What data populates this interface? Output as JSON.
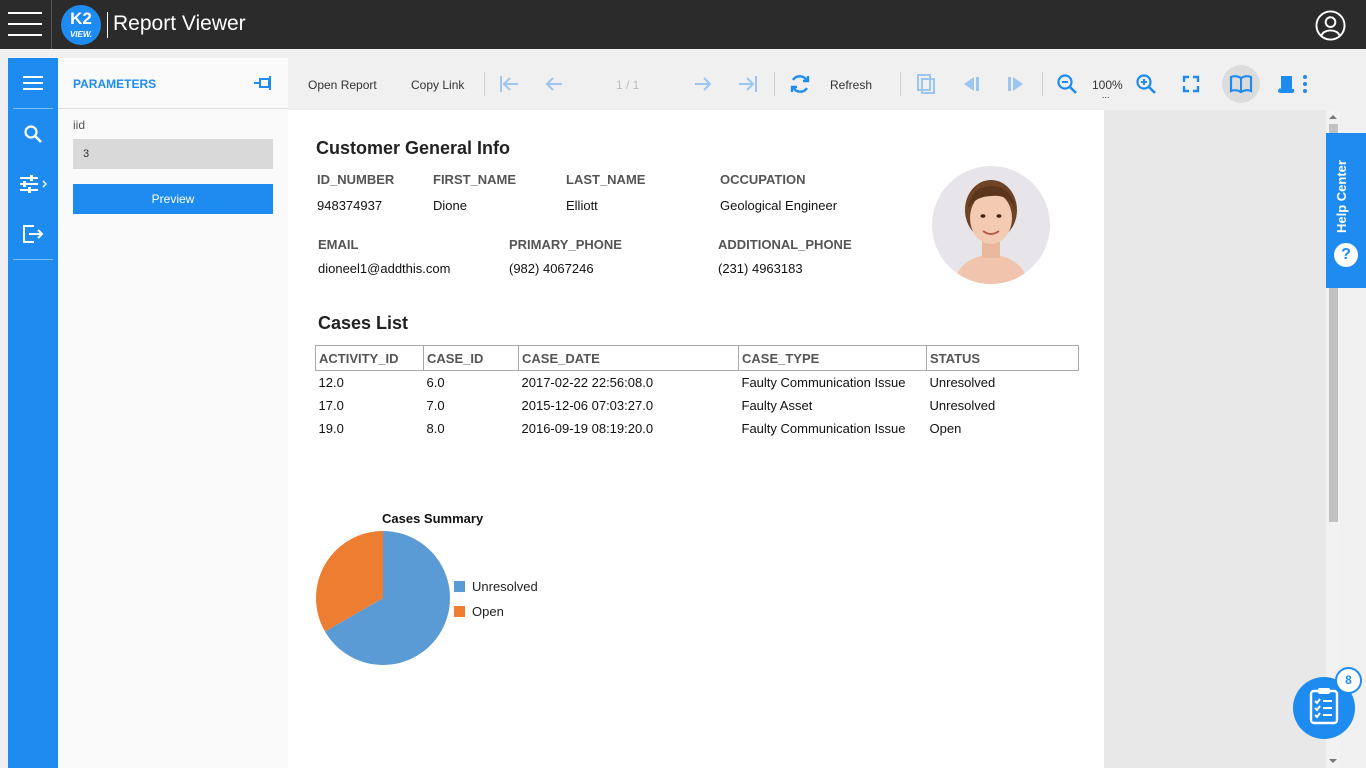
{
  "topbar": {
    "logo_line1": "K2",
    "logo_line2": "VIEW.",
    "app_title": "Report Viewer"
  },
  "icons": {
    "menu": "hamburger-icon",
    "user": "user-circle-icon",
    "nav": [
      "menu-icon",
      "search-icon",
      "sliders-icon",
      "export-icon"
    ]
  },
  "params": {
    "title": "PARAMETERS",
    "field_label": "iid",
    "field_value": "3",
    "preview_label": "Preview"
  },
  "toolbar": {
    "open_report": "Open Report",
    "copy_link": "Copy Link",
    "page_indicator": "1 / 1",
    "refresh": "Refresh",
    "zoom": "100%",
    "zoom_more": "..."
  },
  "report": {
    "customer_title": "Customer General Info",
    "fields_row1": [
      {
        "label": "ID_NUMBER",
        "value": "948374937"
      },
      {
        "label": "FIRST_NAME",
        "value": "Dione"
      },
      {
        "label": "LAST_NAME",
        "value": "Elliott"
      },
      {
        "label": "OCCUPATION",
        "value": "Geological Engineer"
      }
    ],
    "fields_row2": [
      {
        "label": "EMAIL",
        "value": "dioneel1@addthis.com"
      },
      {
        "label": "PRIMARY_PHONE",
        "value": "(982) 4067246"
      },
      {
        "label": "ADDITIONAL_PHONE",
        "value": "(231) 4963183"
      }
    ],
    "cases_title": "Cases List",
    "cases_columns": [
      "ACTIVITY_ID",
      "CASE_ID",
      "CASE_DATE",
      "CASE_TYPE",
      "STATUS"
    ],
    "cases_rows": [
      [
        "12.0",
        "6.0",
        "2017-02-22 22:56:08.0",
        "Faulty Communication Issue",
        "Unresolved"
      ],
      [
        "17.0",
        "7.0",
        "2015-12-06 07:03:27.0",
        "Faulty Asset",
        "Unresolved"
      ],
      [
        "19.0",
        "8.0",
        "2016-09-19 08:19:20.0",
        "Faulty Communication Issue",
        "Open"
      ]
    ]
  },
  "chart_data": {
    "type": "pie",
    "title": "Cases Summary",
    "categories": [
      "Unresolved",
      "Open"
    ],
    "values": [
      2,
      1
    ],
    "colors": [
      "#5b9bd5",
      "#ed7d31"
    ],
    "legend": "right"
  },
  "help": {
    "label": "Help Center",
    "q": "?"
  },
  "fab": {
    "badge": "8"
  },
  "colors": {
    "accent": "#1e8bf0",
    "topbar": "#2b2b2b"
  }
}
